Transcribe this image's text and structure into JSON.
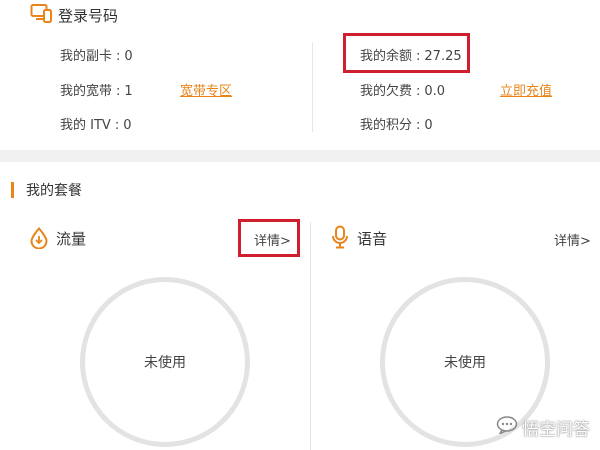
{
  "account": {
    "title": "登录号码",
    "items": [
      {
        "label": "我的副卡",
        "value": "0"
      },
      {
        "label": "我的宽带",
        "value": "1"
      },
      {
        "label": "我的 ITV",
        "value": "0"
      },
      {
        "label": "我的余额",
        "value": "27.25"
      },
      {
        "label": "我的欠费",
        "value": "0.0"
      },
      {
        "label": "我的积分",
        "value": "0"
      }
    ],
    "separator": ":",
    "broadband_link": "宽带专区",
    "recharge_link": "立即充值"
  },
  "package": {
    "title": "我的套餐",
    "data_card": {
      "title": "流量",
      "detail": "详情>",
      "status": "未使用"
    },
    "voice_card": {
      "title": "语音",
      "detail": "详情>",
      "status": "未使用"
    }
  },
  "watermark": {
    "text": "悟空问答"
  },
  "colors": {
    "accent": "#e8841a",
    "highlight": "#cf1f2e",
    "ring": "#e3e3e3",
    "band": "#f0f0f0"
  },
  "icons": {
    "account": "devices-icon",
    "data": "droplet-icon",
    "voice": "microphone-icon"
  }
}
